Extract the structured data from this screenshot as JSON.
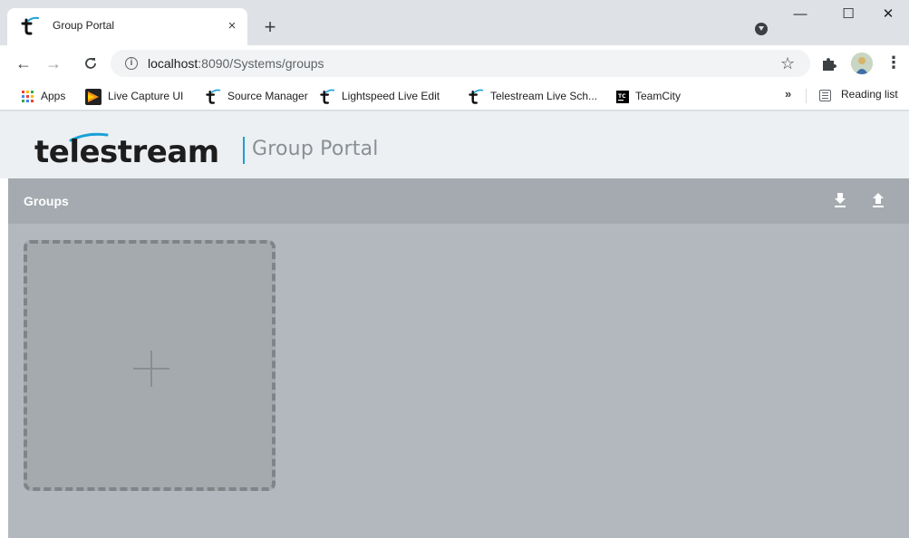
{
  "browser": {
    "tab": {
      "title": "Group Portal",
      "close": "×"
    },
    "new_tab": "+",
    "window": {
      "minimize": "—",
      "maximize": "☐",
      "close": "✕"
    },
    "nav": {
      "back": "←",
      "forward": "→",
      "reload": "C"
    },
    "address": {
      "info": "i",
      "host": "localhost",
      "path": ":8090/Systems/groups"
    },
    "star": "☆",
    "menu": "⋮"
  },
  "bookmarks": {
    "items": [
      {
        "label": "Apps",
        "icon": "apps-grid-icon"
      },
      {
        "label": "Live Capture UI",
        "icon": "live-capture-icon"
      },
      {
        "label": "Source Manager",
        "icon": "telestream-icon"
      },
      {
        "label": "Lightspeed Live Edit",
        "icon": "telestream-icon"
      },
      {
        "label": "Telestream Live Sch...",
        "icon": "telestream-icon"
      },
      {
        "label": "TeamCity",
        "icon": "teamcity-icon"
      }
    ],
    "overflow": "»",
    "reading_list": "Reading list"
  },
  "page": {
    "brand": {
      "logo_text": "telestream",
      "portal_title": "Group Portal"
    },
    "groups": {
      "title": "Groups"
    }
  },
  "colors": {
    "telestream_blue": "#1aa0d8",
    "groups_bar": "#a4aab0",
    "content_bg": "#b2b8be",
    "tile_bg": "#a5aaaf"
  }
}
